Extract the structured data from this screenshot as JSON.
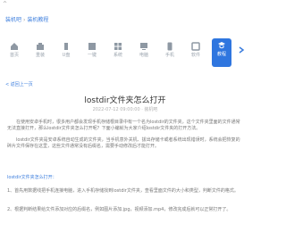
{
  "topbar": {
    "mark": "^"
  },
  "breadcrumb": {
    "home": "装机吧",
    "section": "装机教程"
  },
  "categories": [
    {
      "label": "首页",
      "icon": "home-icon"
    },
    {
      "label": "重装",
      "icon": "reinstall-icon"
    },
    {
      "label": "U盘",
      "icon": "usb-icon"
    },
    {
      "label": "一键",
      "icon": "oneclick-icon"
    },
    {
      "label": "系统",
      "icon": "system-icon"
    },
    {
      "label": "电脑",
      "icon": "computer-icon"
    },
    {
      "label": "手机",
      "icon": "phone-icon"
    },
    {
      "label": "软件",
      "icon": "software-icon"
    },
    {
      "label": "教程",
      "icon": "tutorial-icon",
      "active": true
    },
    {
      "label": "",
      "icon": "chevron-right-icon"
    }
  ],
  "subcrumb": "< 返回上一页",
  "article": {
    "title": "lostdir文件夹怎么打开",
    "meta": "2022-07-12 09:00:00 · 装机吧",
    "paragraphs": [
      "在使用安卓手机时，很多用户都会发现手机存储根目录中有一个名为lostdir的文件夹，这个文件夹里面的文件通常无法直接打开，那么lostdir文件夹怎么打开呢？下面小编就为大家介绍lostdir文件夹的打开方法。",
      "lostdir文件夹是安卓系统自动生成的文件夹，当手机意外关机、拔出存储卡或者系统出现错误时，系统会把恢复的碎片文件保存在这里，这些文件通常没有后缀名，需要手动修改后才能打开。"
    ],
    "subheading": "lostdir文件夹怎么打开：",
    "step1": "1、首先用数据线把手机连接电脑，进入手机存储找到lostdir文件夹，查看里面文件的大小和类型，判断文件的格式。",
    "step2": "2、根据判断结果给文件添加对应的后缀名，例如图片添加.jpg，视频添加.mp4，修改完成后就可以正常打开了。"
  }
}
